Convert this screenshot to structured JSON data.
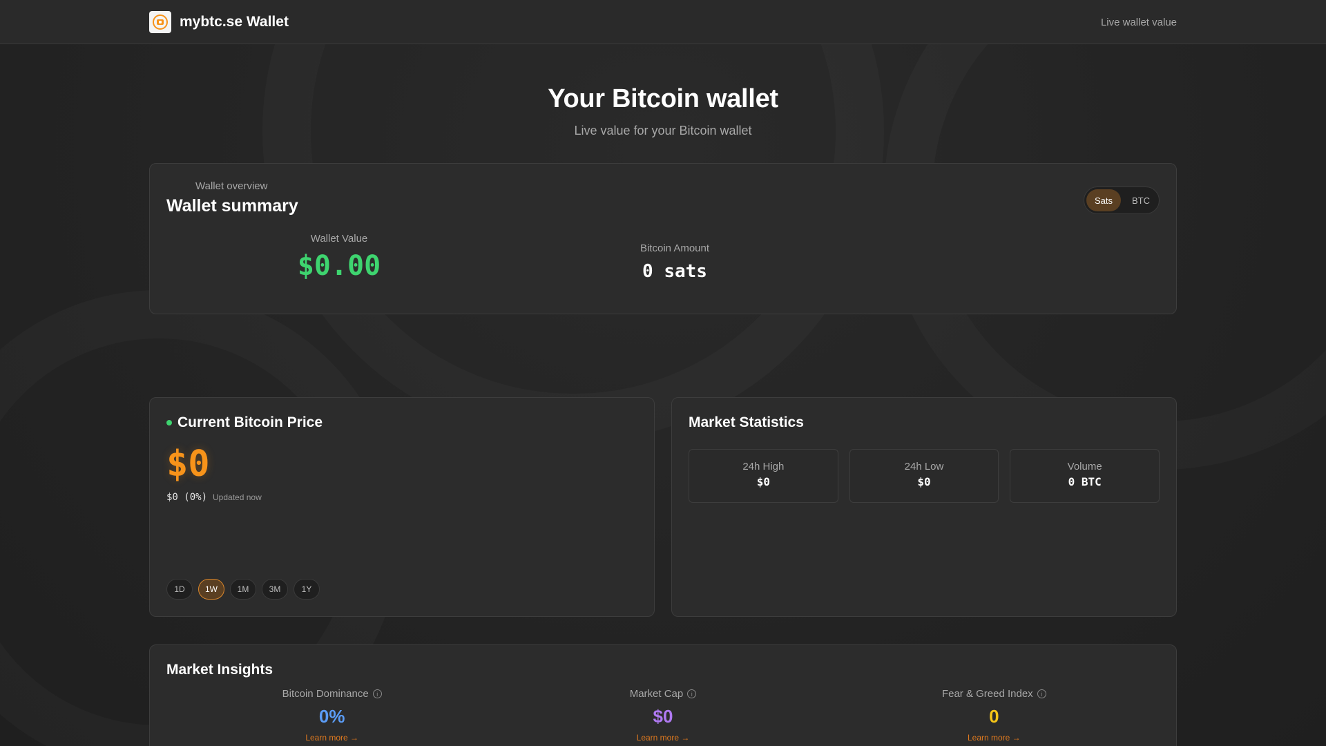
{
  "header": {
    "brand_title": "mybtc.se Wallet",
    "link_label": "Live wallet value",
    "logo_icon": "bitcoin-wallet-icon"
  },
  "hero": {
    "title": "Your Bitcoin wallet",
    "subtitle": "Live value for your Bitcoin wallet"
  },
  "wallet": {
    "eyebrow": "Wallet overview",
    "title": "Wallet summary",
    "toggle": {
      "sats_label": "Sats",
      "btc_label": "BTC",
      "selected": "Sats"
    },
    "value_label": "Wallet Value",
    "value": "$0.00",
    "amount_label": "Bitcoin Amount",
    "amount": "0 sats"
  },
  "price": {
    "title": "Current Bitcoin Price",
    "value": "$0",
    "change": "$0 (0%)",
    "updated": "Updated now",
    "ranges": [
      "1D",
      "1W",
      "1M",
      "3M",
      "1Y"
    ],
    "selected_range": "1W"
  },
  "market_stats": {
    "title": "Market Statistics",
    "high_label": "24h High",
    "high_value": "$0",
    "low_label": "24h Low",
    "low_value": "$0",
    "volume_label": "Volume",
    "volume_value": "0 BTC"
  },
  "insights": {
    "title": "Market Insights",
    "items": [
      {
        "label": "Bitcoin Dominance",
        "value": "0%",
        "link": "Learn more →",
        "color": "#5b9cf6"
      },
      {
        "label": "Market Cap",
        "value": "$0",
        "link": "Learn more →",
        "color": "#b079f2"
      },
      {
        "label": "Fear & Greed Index",
        "value": "0",
        "link": "Learn more →",
        "color": "#f5c518"
      }
    ]
  },
  "colors": {
    "accent": "#f7931a",
    "positive": "#3ed46f"
  }
}
